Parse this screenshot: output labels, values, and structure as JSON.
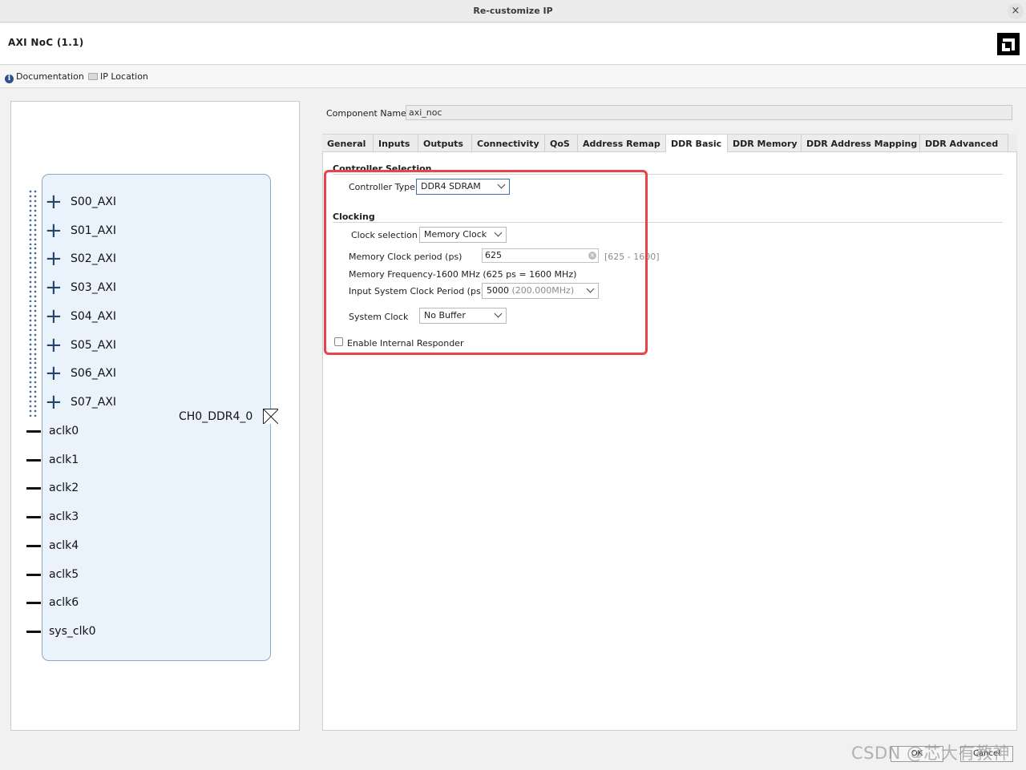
{
  "window": {
    "title": "Re-customize IP",
    "close_glyph": "×"
  },
  "header": {
    "ip_name": "AXI NoC (1.1)",
    "logo_icon": "amd-logo-icon"
  },
  "toolbar": {
    "documentation": "Documentation",
    "ip_location": "IP Location"
  },
  "symbol": {
    "slave_ports": [
      "S00_AXI",
      "S01_AXI",
      "S02_AXI",
      "S03_AXI",
      "S04_AXI",
      "S05_AXI",
      "S06_AXI",
      "S07_AXI"
    ],
    "clock_ports": [
      "aclk0",
      "aclk1",
      "aclk2",
      "aclk3",
      "aclk4",
      "aclk5",
      "aclk6",
      "sys_clk0"
    ],
    "output_port": "CH0_DDR4_0",
    "expand_glyph": "+"
  },
  "component": {
    "label": "Component Name",
    "value": "axi_noc"
  },
  "tabs": [
    {
      "label": "General"
    },
    {
      "label": "Inputs"
    },
    {
      "label": "Outputs"
    },
    {
      "label": "Connectivity"
    },
    {
      "label": "QoS"
    },
    {
      "label": "Address Remap"
    },
    {
      "label": "DDR Basic",
      "active": true
    },
    {
      "label": "DDR Memory"
    },
    {
      "label": "DDR Address Mapping"
    },
    {
      "label": "DDR Advanced"
    }
  ],
  "ddr_basic": {
    "controller_section": "Controller Selection",
    "controller_type_label": "Controller Type",
    "controller_type_value": "DDR4 SDRAM",
    "clocking_section": "Clocking",
    "clock_selection_label": "Clock selection",
    "clock_selection_value": "Memory Clock",
    "memory_clock_period_label": "Memory Clock period (ps)",
    "memory_clock_period_value": "625",
    "memory_clock_period_range": "[625 - 1600]",
    "memory_frequency_text": "Memory Frequency-1600 MHz (625 ps = 1600 MHz)",
    "input_system_clock_label": "Input System Clock Period (ps)",
    "input_system_clock_value": "5000",
    "input_system_clock_hint": "(200.000MHz)",
    "system_clock_label": "System Clock",
    "system_clock_value": "No Buffer",
    "enable_responder_label": "Enable Internal Responder",
    "enable_responder_checked": false
  },
  "footer": {
    "ok": "OK",
    "cancel": "Cancel",
    "watermark": "CSDN @芯大有教神"
  },
  "colors": {
    "highlight": "#e8434a",
    "block_fill": "#eaf3fb",
    "block_border": "#8fa6c4",
    "port_plus": "#23446b"
  }
}
